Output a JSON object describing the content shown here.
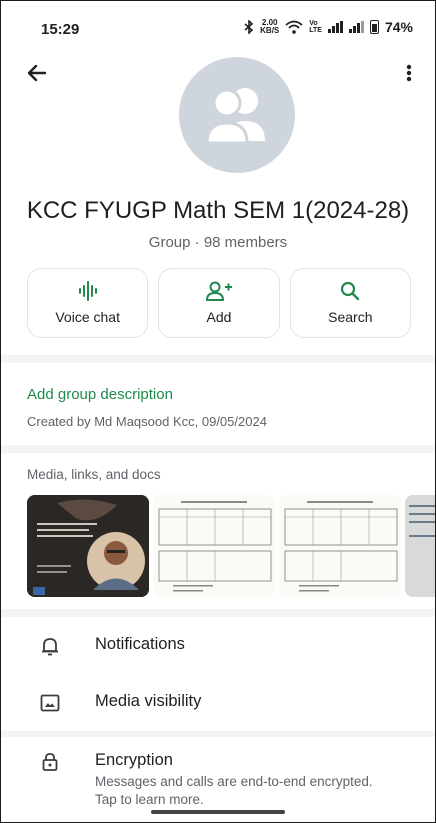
{
  "status_bar": {
    "time": "15:29",
    "speed": "2.00",
    "speed_unit": "KB/S",
    "battery": "74%"
  },
  "group": {
    "name": "KCC FYUGP Math SEM 1(2024-28)",
    "subtitle": "Group · 98 members"
  },
  "actions": [
    {
      "label": "Voice chat",
      "icon": "voice-waveform-icon"
    },
    {
      "label": "Add",
      "icon": "add-person-icon"
    },
    {
      "label": "Search",
      "icon": "search-icon"
    }
  ],
  "description": {
    "link": "Add group description",
    "created": "Created by Md Maqsood Kcc, 09/05/2024"
  },
  "media": {
    "title": "Media, links, and docs"
  },
  "settings": {
    "notifications": "Notifications",
    "media_visibility": "Media visibility",
    "encryption": "Encryption",
    "encryption_sub": "Messages and calls are end-to-end encrypted. Tap to learn more."
  },
  "colors": {
    "accent": "#1f8a4c",
    "avatar_bg": "#cfd5dc"
  }
}
